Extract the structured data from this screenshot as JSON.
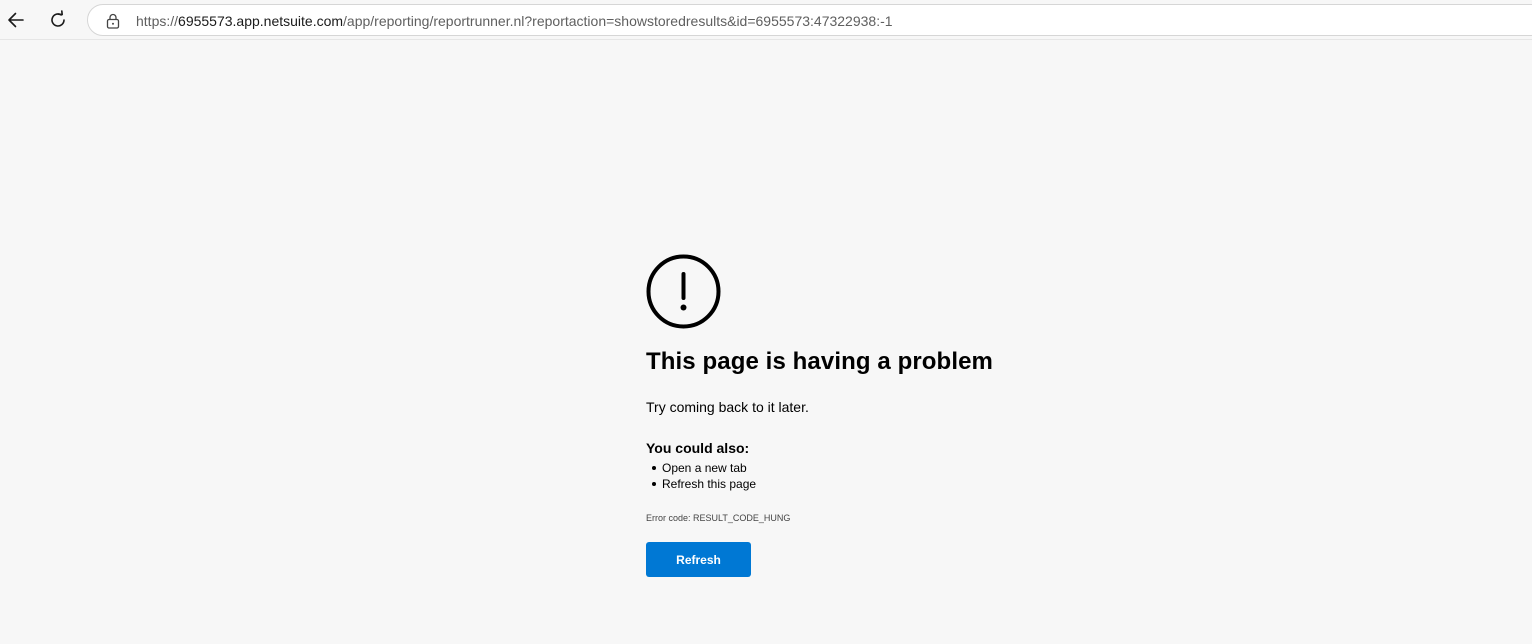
{
  "browser": {
    "back_icon": "arrow-left-icon",
    "reload_icon": "reload-icon",
    "lock_icon": "lock-icon",
    "url_prefix": "https://",
    "url_host": "6955573.app.netsuite.com",
    "url_path": "/app/reporting/reportrunner.nl?reportaction=showstoredresults&id=6955573:47322938:-1"
  },
  "error_page": {
    "icon": "exclamation-circle-icon",
    "title": "This page is having a problem",
    "subtitle": "Try coming back to it later.",
    "also_heading": "You could also:",
    "suggestions": [
      "Open a new tab",
      "Refresh this page"
    ],
    "error_code": "Error code: RESULT_CODE_HUNG",
    "refresh_label": "Refresh"
  },
  "colors": {
    "accent": "#0078d4",
    "background": "#f7f7f7"
  }
}
